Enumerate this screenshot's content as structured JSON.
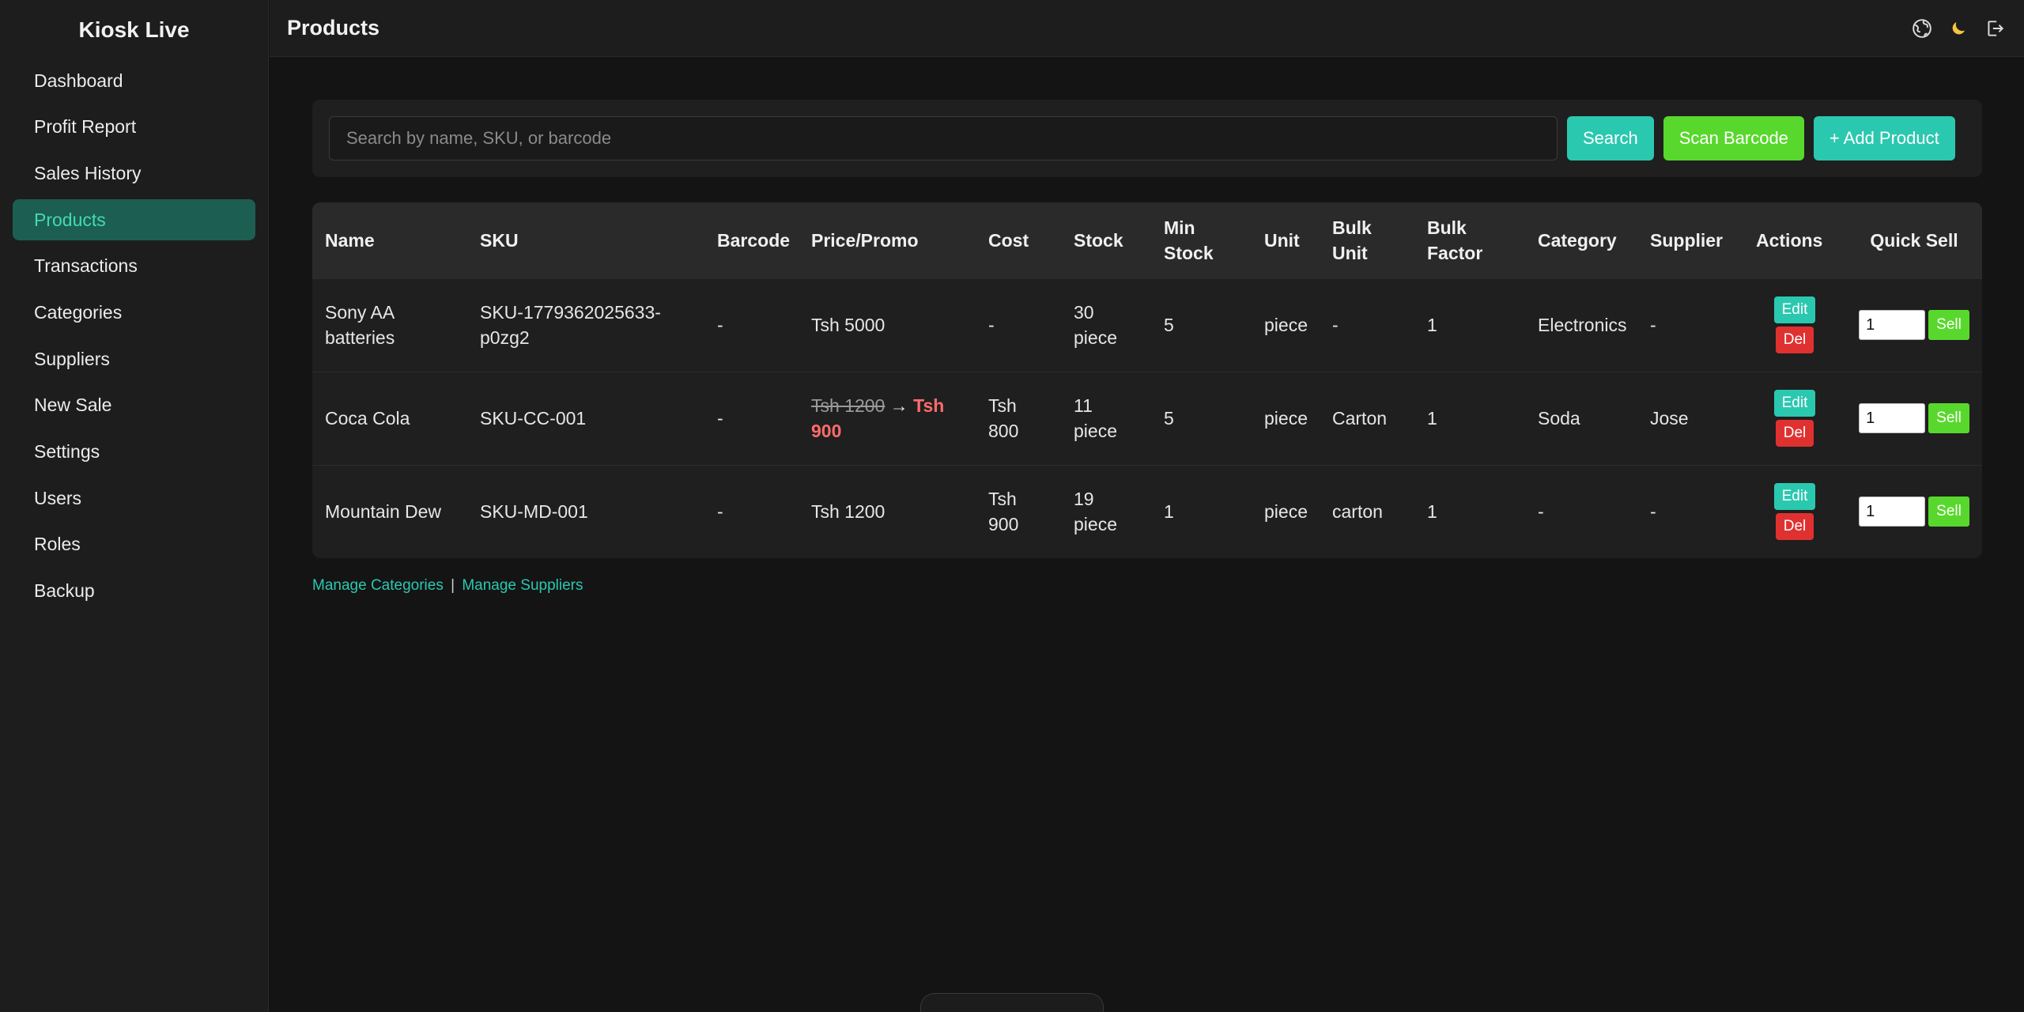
{
  "app": {
    "name": "Kiosk Live"
  },
  "sidebar": {
    "items": [
      {
        "label": "Dashboard"
      },
      {
        "label": "Profit Report"
      },
      {
        "label": "Sales History"
      },
      {
        "label": "Products",
        "active": true
      },
      {
        "label": "Transactions"
      },
      {
        "label": "Categories"
      },
      {
        "label": "Suppliers"
      },
      {
        "label": "New Sale"
      },
      {
        "label": "Settings"
      },
      {
        "label": "Users"
      },
      {
        "label": "Roles"
      },
      {
        "label": "Backup"
      }
    ]
  },
  "header": {
    "title": "Products",
    "icons": [
      "globe-icon",
      "moon-icon",
      "logout-icon"
    ]
  },
  "search": {
    "placeholder": "Search by name, SKU, or barcode",
    "value": "",
    "search_label": "Search",
    "scan_label": "Scan Barcode",
    "add_label": "+ Add Product"
  },
  "table": {
    "columns": [
      "Name",
      "SKU",
      "Barcode",
      "Price/Promo",
      "Cost",
      "Stock",
      "Min Stock",
      "Unit",
      "Bulk Unit",
      "Bulk Factor",
      "Category",
      "Supplier",
      "Actions",
      "Quick Sell"
    ],
    "edit_label": "Edit",
    "del_label": "Del",
    "sell_label": "Sell",
    "rows": [
      {
        "name": "Sony AA batteries",
        "sku": "SKU-1779362025633-p0zg2",
        "barcode": "-",
        "price": "Tsh 5000",
        "old_price": "",
        "arrow": "",
        "promo": "",
        "cost": "-",
        "stock": "30 piece",
        "min_stock": "5",
        "unit": "piece",
        "bulk_unit": "-",
        "bulk_factor": "1",
        "category": "Electronics",
        "supplier": "-",
        "qty": "1"
      },
      {
        "name": "Coca Cola",
        "sku": "SKU-CC-001",
        "barcode": "-",
        "price": "",
        "old_price": "Tsh 1200",
        "arrow": " → ",
        "promo": "Tsh 900",
        "cost": "Tsh 800",
        "stock": "11 piece",
        "min_stock": "5",
        "unit": "piece",
        "bulk_unit": "Carton",
        "bulk_factor": "1",
        "category": "Soda",
        "supplier": "Jose",
        "qty": "1"
      },
      {
        "name": "Mountain Dew",
        "sku": "SKU-MD-001",
        "barcode": "-",
        "price": "Tsh 1200",
        "old_price": "",
        "arrow": "",
        "promo": "",
        "cost": "Tsh 900",
        "stock": "19 piece",
        "min_stock": "1",
        "unit": "piece",
        "bulk_unit": "carton",
        "bulk_factor": "1",
        "category": "-",
        "supplier": "-",
        "qty": "1"
      }
    ]
  },
  "footer_links": {
    "manage_categories": "Manage Categories",
    "separator": "|",
    "manage_suppliers": "Manage Suppliers"
  },
  "colors": {
    "accent": "#2bc8b0",
    "green": "#58d82c",
    "danger": "#e03131",
    "active_nav_bg": "#1c5e52",
    "promo": "#ff6b6b"
  }
}
